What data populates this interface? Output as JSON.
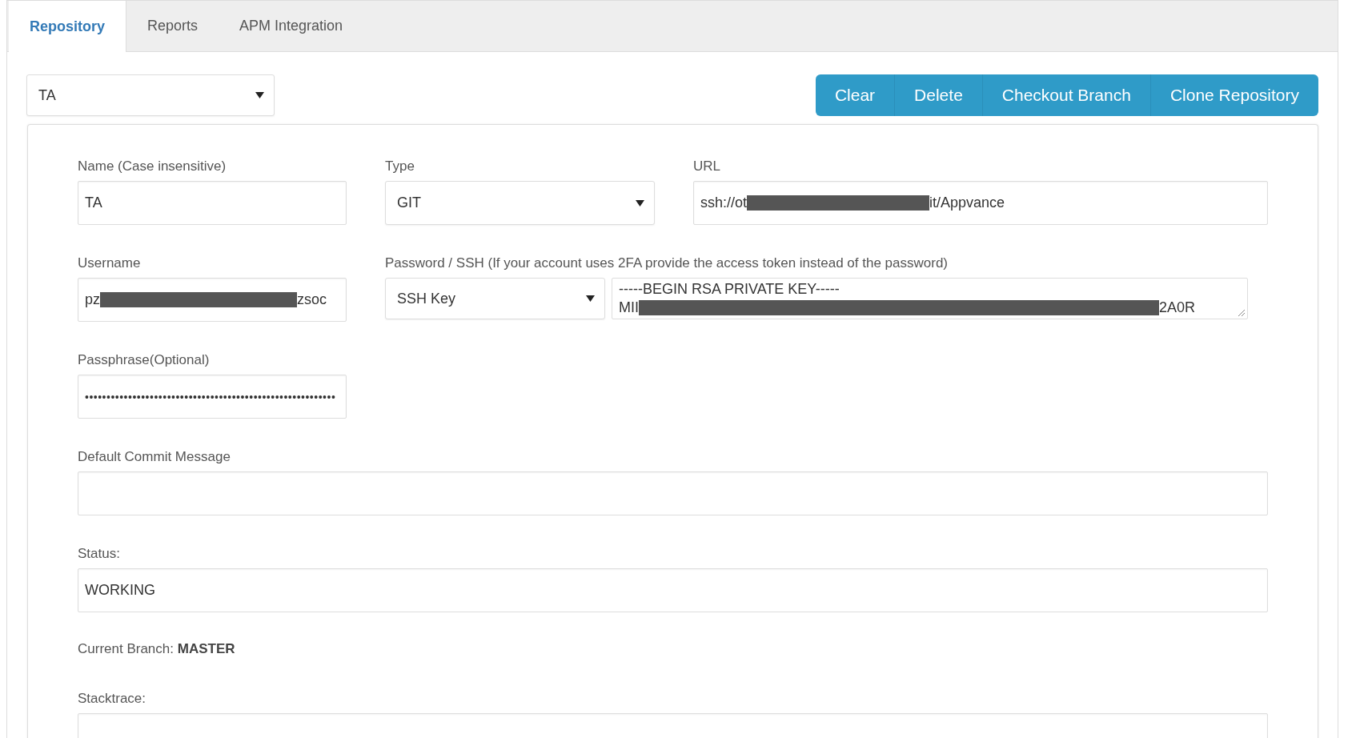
{
  "tabs": [
    {
      "label": "Repository",
      "selected": true
    },
    {
      "label": "Reports",
      "selected": false
    },
    {
      "label": "APM Integration",
      "selected": false
    }
  ],
  "repository_select": {
    "value": "TA"
  },
  "actions": [
    "Clear",
    "Delete",
    "Checkout Branch",
    "Clone Repository"
  ],
  "form": {
    "name": {
      "label": "Name (Case insensitive)",
      "value": [
        {
          "kind": "text",
          "text": "TA"
        }
      ]
    },
    "type": {
      "label": "Type",
      "value": "GIT"
    },
    "url": {
      "label": "URL",
      "value": [
        {
          "kind": "text",
          "text": "ssh://ot"
        },
        {
          "kind": "redacted"
        },
        {
          "kind": "text",
          "text": "it/Appvance"
        }
      ]
    },
    "username": {
      "label": "Username",
      "value": [
        {
          "kind": "text",
          "text": "pz"
        },
        {
          "kind": "redacted"
        },
        {
          "kind": "text",
          "text": "zsoc"
        }
      ]
    },
    "password": {
      "label": "Password / SSH (If your account uses 2FA provide the access token instead of the password)",
      "method": "SSH Key",
      "key_lines": [
        [
          {
            "kind": "text",
            "text": "-----BEGIN RSA PRIVATE KEY-----"
          }
        ],
        [
          {
            "kind": "text",
            "text": "MII"
          },
          {
            "kind": "redacted"
          },
          {
            "kind": "text",
            "text": "2A0R"
          }
        ]
      ]
    },
    "passphrase": {
      "label": "Passphrase(Optional)",
      "value": "••••••••••••••••••••••••••••••••••••••••••••••••••••••••••"
    },
    "commit_message": {
      "label": "Default Commit Message"
    },
    "status": {
      "label": "Status:",
      "value": "WORKING"
    },
    "current_branch": {
      "text": "Current Branch: **MASTER**"
    },
    "stacktrace": {
      "label": "Stacktrace:"
    }
  }
}
